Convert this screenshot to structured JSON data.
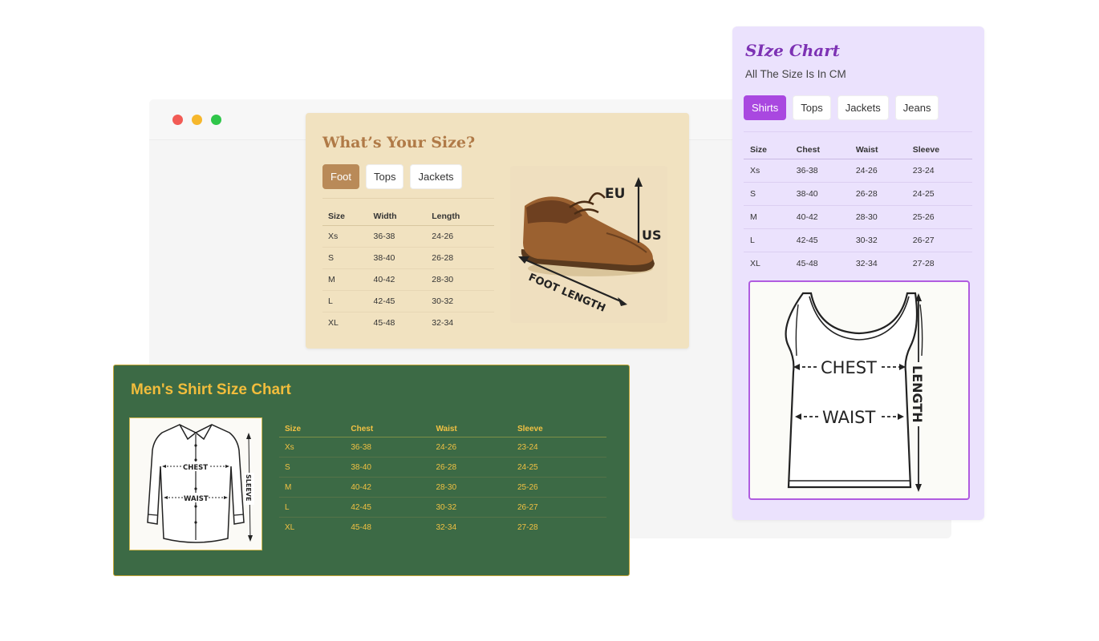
{
  "foot_card": {
    "title": "What’s Your Size?",
    "tabs": [
      "Foot",
      "Tops",
      "Jackets"
    ],
    "columns": [
      "Size",
      "Width",
      "Length"
    ],
    "rows": [
      [
        "Xs",
        "36-38",
        "24-26"
      ],
      [
        "S",
        "38-40",
        "26-28"
      ],
      [
        "M",
        "40-42",
        "28-30"
      ],
      [
        "L",
        "42-45",
        "30-32"
      ],
      [
        "XL",
        "45-48",
        "32-34"
      ]
    ],
    "illustration": {
      "label_eu": "EU",
      "label_us": "US",
      "label_length": "FOOT LENGTH"
    }
  },
  "size_chart_card": {
    "title": "SIze Chart",
    "subtitle": "All The Size Is In CM",
    "tabs": [
      "Shirts",
      "Tops",
      "Jackets",
      "Jeans"
    ],
    "columns": [
      "Size",
      "Chest",
      "Waist",
      "Sleeve"
    ],
    "rows": [
      [
        "Xs",
        "36-38",
        "24-26",
        "23-24"
      ],
      [
        "S",
        "38-40",
        "26-28",
        "24-25"
      ],
      [
        "M",
        "40-42",
        "28-30",
        "25-26"
      ],
      [
        "L",
        "42-45",
        "30-32",
        "26-27"
      ],
      [
        "XL",
        "45-48",
        "32-34",
        "27-28"
      ]
    ],
    "illustration": {
      "label_chest": "CHEST",
      "label_waist": "WAIST",
      "label_length": "LENGTH"
    }
  },
  "shirt_card": {
    "title": "Men's Shirt Size Chart",
    "columns": [
      "Size",
      "Chest",
      "Waist",
      "Sleeve"
    ],
    "rows": [
      [
        "Xs",
        "36-38",
        "24-26",
        "23-24"
      ],
      [
        "S",
        "38-40",
        "26-28",
        "24-25"
      ],
      [
        "M",
        "40-42",
        "28-30",
        "25-26"
      ],
      [
        "L",
        "42-45",
        "30-32",
        "26-27"
      ],
      [
        "XL",
        "45-48",
        "32-34",
        "27-28"
      ]
    ],
    "illustration": {
      "label_chest": "CHEST",
      "label_waist": "WAIST",
      "label_sleeve": "SLEEVE"
    }
  },
  "colors": {
    "foot_accent": "#b98a58",
    "purple_accent": "#a948e0",
    "green_bg": "#3c6a45",
    "green_text": "#f2c143"
  }
}
